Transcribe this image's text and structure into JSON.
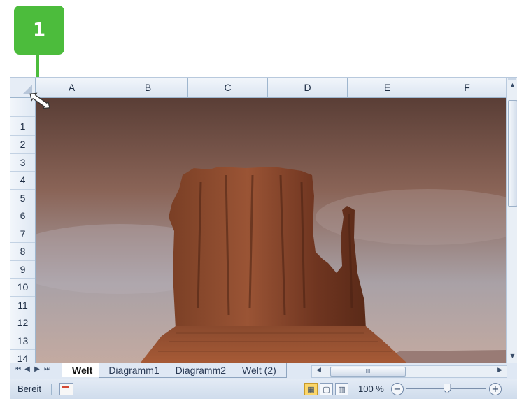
{
  "callout": {
    "number": "1",
    "color": "#4cbc3c"
  },
  "columns": [
    "A",
    "B",
    "C",
    "D",
    "E",
    "F"
  ],
  "rows": [
    "1",
    "2",
    "3",
    "4",
    "5",
    "6",
    "7",
    "8",
    "9",
    "10",
    "11",
    "12",
    "13",
    "14"
  ],
  "picture": {
    "icon": "desert-butte-photo"
  },
  "sheet_tabs": [
    {
      "label": "Welt",
      "active": true
    },
    {
      "label": "Diagramm1",
      "active": false
    },
    {
      "label": "Diagramm2",
      "active": false
    },
    {
      "label": "Welt (2)",
      "active": false
    }
  ],
  "status_bar": {
    "ready_label": "Bereit",
    "zoom_label": "100 %",
    "zoom_minus": "−",
    "zoom_plus": "+"
  },
  "hscroll_thumb_text": "III"
}
